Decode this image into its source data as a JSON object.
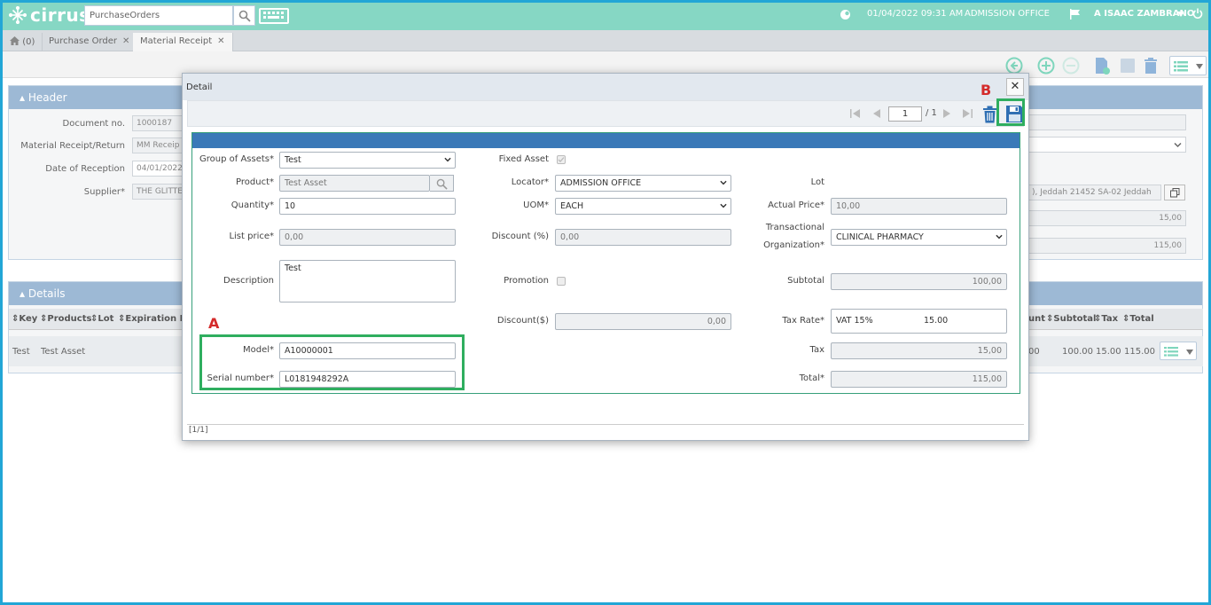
{
  "app": {
    "brand": "cirrus",
    "search_value": "PurchaseOrders",
    "datetime": "01/04/2022 09:31 AM",
    "location": "ADMISSION OFFICE",
    "user": "A ISAAC ZAMBRANO"
  },
  "tabs": [
    {
      "label": "(0)"
    },
    {
      "label": "Purchase Order"
    },
    {
      "label": "Material Receipt"
    }
  ],
  "header_panel": {
    "title": "Header",
    "fields": [
      {
        "label": "Document no.",
        "value": "1000187"
      },
      {
        "label": "Material Receipt/Return",
        "value": "MM Receip"
      },
      {
        "label": "Date of Reception",
        "value": "04/01/2022"
      },
      {
        "label": "Supplier*",
        "value": "THE GLITTE"
      }
    ],
    "address": "), Jeddah 21452 SA-02 Jeddah",
    "amount1": "15,00",
    "amount2": "115,00"
  },
  "details_panel": {
    "title": "Details",
    "columns_left": [
      "Key",
      "Products",
      "Lot",
      "Expiration Dat"
    ],
    "columns_right": [
      "unt",
      "Subtotal",
      "Tax",
      "Total"
    ],
    "row": {
      "key": "Test",
      "product": "Test Asset",
      "amount_cut": "00",
      "subtotal": "100.00",
      "tax": "15.00",
      "total": "115.00"
    }
  },
  "modal": {
    "title": "Detail",
    "page": "1",
    "page_of": "/ 1",
    "status": "[1/1]",
    "fields": {
      "group_of_assets": {
        "label": "Group of Assets*",
        "value": "Test"
      },
      "product": {
        "label": "Product*",
        "value": "Test Asset"
      },
      "quantity": {
        "label": "Quantity*",
        "value": "10"
      },
      "list_price": {
        "label": "List price*",
        "value": "0,00"
      },
      "description": {
        "label": "Description",
        "value": "Test"
      },
      "model": {
        "label": "Model*",
        "value": "A10000001"
      },
      "serial_number": {
        "label": "Serial number*",
        "value": "L0181948292A"
      },
      "fixed_asset": {
        "label": "Fixed Asset"
      },
      "locator": {
        "label": "Locator*",
        "value": "ADMISSION OFFICE"
      },
      "uom": {
        "label": "UOM*",
        "value": "EACH"
      },
      "discount_pct": {
        "label": "Discount (%)",
        "value": "0,00"
      },
      "promotion": {
        "label": "Promotion"
      },
      "discount_amt": {
        "label": "Discount($)",
        "value": "0,00"
      },
      "lot": {
        "label": "Lot"
      },
      "actual_price": {
        "label": "Actual Price*",
        "value": "10,00"
      },
      "trans_org": {
        "label_line1": "Transactional",
        "label_line2": "Organization*",
        "value": "CLINICAL PHARMACY"
      },
      "subtotal": {
        "label": "Subtotal",
        "value": "100,00"
      },
      "tax_rate": {
        "label": "Tax Rate*",
        "name": "VAT 15%",
        "value": "15.00"
      },
      "tax": {
        "label": "Tax",
        "value": "15,00"
      },
      "total": {
        "label": "Total*",
        "value": "115,00"
      }
    }
  },
  "annotations": {
    "a": "A",
    "b": "B"
  },
  "colors": {
    "topbar": "#86d7c4",
    "form_header": "#3a79b8",
    "highlight": "#2fae5f",
    "annotation": "#d42b2b",
    "icon_green": "#5cc9a8",
    "icon_blue": "#2f6fb3"
  }
}
